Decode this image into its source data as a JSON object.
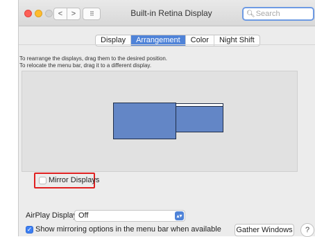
{
  "window": {
    "title": "Built-in Retina Display",
    "search_placeholder": "Search",
    "nav": {
      "back": "<",
      "forward": ">",
      "grid": "⠿"
    }
  },
  "tabs": [
    "Display",
    "Arrangement",
    "Color",
    "Night Shift"
  ],
  "selected_tab": "Arrangement",
  "arrangement": {
    "instructions_line1": "To rearrange the displays, drag them to the desired position.",
    "instructions_line2": "To relocate the menu bar, drag it to a different display.",
    "mirror_label": "Mirror Displays",
    "mirror_checked": false
  },
  "footer": {
    "airplay_label": "AirPlay Display:",
    "airplay_value": "Off",
    "show_mirroring_label": "Show mirroring options in the menu bar when available",
    "show_mirroring_checked": true,
    "gather_button": "Gather Windows",
    "help_button": "?"
  },
  "colors": {
    "accent": "#4f83d8",
    "display_fill": "#6386c6",
    "highlight_border": "#e02020"
  }
}
